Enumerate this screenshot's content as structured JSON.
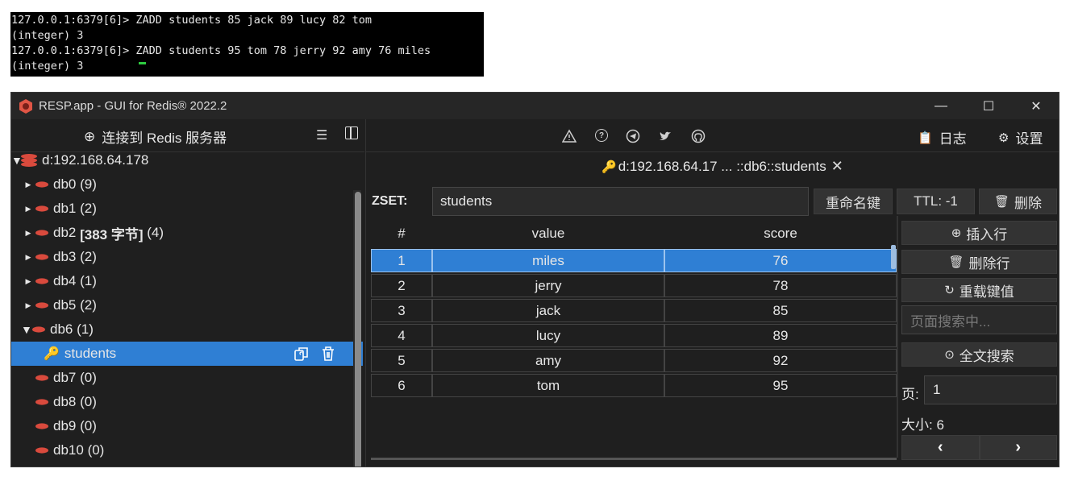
{
  "terminal": {
    "lines": [
      "127.0.0.1:6379[6]> ZADD students 85 jack 89 lucy 82 tom",
      "(integer) 3",
      "127.0.0.1:6379[6]> ZADD students 95 tom 78 jerry 92 amy 76 miles",
      "(integer) 3"
    ]
  },
  "window": {
    "title": "RESP.app - GUI for Redis® 2022.2",
    "minimize": "—",
    "maximize": "☐",
    "close": "✕"
  },
  "left_toolbar": {
    "connect_label": "连接到 Redis 服务器",
    "plus_icon": "⊕",
    "list_icon": "☰"
  },
  "tree": {
    "server": "d:192.168.64.178",
    "dbs": [
      {
        "name": "db0",
        "info": "(9)"
      },
      {
        "name": "db1",
        "info": "(2)"
      },
      {
        "name": "db2",
        "size": "[383 字节]",
        "info": "(4)"
      },
      {
        "name": "db3",
        "info": "(2)"
      },
      {
        "name": "db4",
        "info": "(1)"
      },
      {
        "name": "db5",
        "info": "(2)"
      },
      {
        "name": "db6",
        "info": "(1)"
      },
      {
        "name": "db7",
        "info": "(0)"
      },
      {
        "name": "db8",
        "info": "(0)"
      },
      {
        "name": "db9",
        "info": "(0)"
      },
      {
        "name": "db10",
        "info": "(0)"
      }
    ],
    "selected_key": "students"
  },
  "right_toolbar": {
    "log_label": "日志",
    "settings_label": "设置"
  },
  "tab": {
    "label": "d:192.168.64.17 ... ::db6::students",
    "close": "✕"
  },
  "key_editor": {
    "type_label": "ZSET:",
    "key_name": "students",
    "rename_label": "重命名键",
    "ttl_label": "TTL:  -1",
    "delete_label": "删除"
  },
  "table": {
    "headers": [
      "#",
      "value",
      "score"
    ],
    "rows": [
      {
        "index": "1",
        "value": "miles",
        "score": "76"
      },
      {
        "index": "2",
        "value": "jerry",
        "score": "78"
      },
      {
        "index": "3",
        "value": "jack",
        "score": "85"
      },
      {
        "index": "4",
        "value": "lucy",
        "score": "89"
      },
      {
        "index": "5",
        "value": "amy",
        "score": "92"
      },
      {
        "index": "6",
        "value": "tom",
        "score": "95"
      }
    ],
    "selected_row": 1
  },
  "side_actions": {
    "insert_row": "插入行",
    "delete_row": "删除行",
    "reload": "重载键值",
    "search_placeholder": "页面搜索中...",
    "fulltext": "全文搜索",
    "page_label": "页:",
    "page_value": "1",
    "size_text": "大小: 6",
    "prev": "‹",
    "next": "›"
  }
}
